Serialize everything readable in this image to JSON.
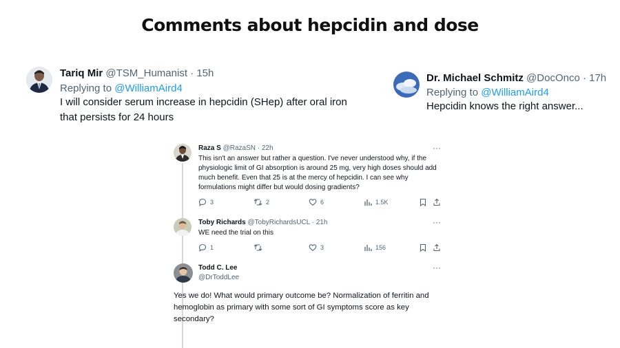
{
  "slide": {
    "title": "Comments about hepcidin and dose"
  },
  "tweets": {
    "tariq": {
      "name": "Tariq Mir",
      "meta": " @TSM_Humanist · 15h",
      "replying_prefix": "Replying to ",
      "replying_to": "@WilliamAird4",
      "body": "I will consider serum increase in hepcidin (SHep) after oral iron that persists for 24 hours"
    },
    "schmitz": {
      "name": "Dr. Michael Schmitz",
      "meta": " @DocOnco · 17h",
      "replying_prefix": "Replying to ",
      "replying_to": "@WilliamAird4",
      "body": "Hepcidin knows the right answer..."
    }
  },
  "thread": {
    "raza": {
      "name": "Raza S",
      "meta": " @RazaSN · 22h",
      "more": "···",
      "body": "This isn't an answer but rather a question. I've never understood why, if the physiologic limit of GI absorption is around 25 mg, very high doses should add much benefit. Even that 25 is at the mercy of hepcidin. I can see why formulations might differ but would dosing gradients?",
      "replies": "3",
      "retweets": "2",
      "likes": "6",
      "views": "1.5K"
    },
    "toby": {
      "name": "Toby Richards",
      "meta": " @TobyRichardsUCL · 21h",
      "more": "···",
      "body": "WE need the trial on this",
      "replies": "1",
      "retweets": "",
      "likes": "3",
      "views": "156"
    },
    "todd": {
      "name": "Todd C. Lee",
      "handle": "@DrToddLee",
      "more": "···",
      "body": "Yes we do! What would primary outcome be? Normalization of ferritin and hemoglobin as primary with some sort of GI symptoms score as key secondary?"
    }
  },
  "colors": {
    "link": "#1d9bf0",
    "muted": "#536471",
    "text": "#0f1419",
    "line": "#cfd9de"
  }
}
